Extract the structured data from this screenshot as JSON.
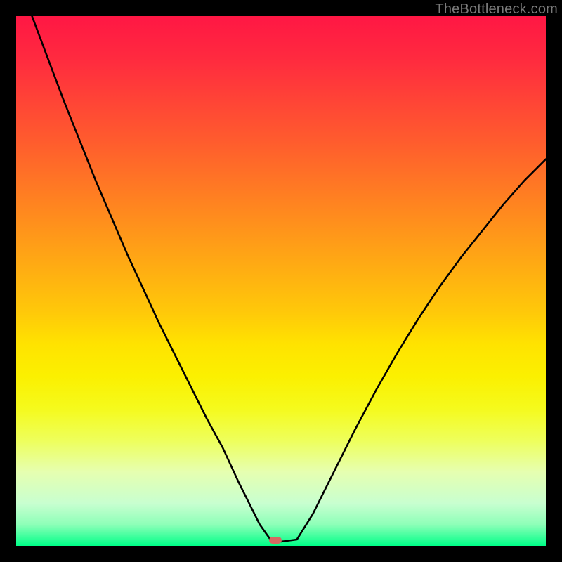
{
  "watermark": "TheBottleneck.com",
  "marker": {
    "x_pct": 49.0,
    "y_pct": 99.0
  },
  "chart_data": {
    "type": "line",
    "title": "",
    "xlabel": "",
    "ylabel": "",
    "xlim": [
      0,
      100
    ],
    "ylim": [
      0,
      100
    ],
    "grid": false,
    "legend": false,
    "series": [
      {
        "name": "bottleneck-curve",
        "x": [
          0,
          3,
          6,
          9,
          12,
          15,
          18,
          21,
          24,
          27,
          30,
          33,
          36,
          39,
          42,
          44,
          46,
          48,
          50,
          53,
          56,
          60,
          64,
          68,
          72,
          76,
          80,
          84,
          88,
          92,
          96,
          100
        ],
        "y": [
          108,
          100,
          92,
          84,
          76.5,
          69,
          62,
          55,
          48.5,
          42,
          36,
          30,
          24,
          18.5,
          12,
          8,
          4,
          1.2,
          0.8,
          1.2,
          6,
          14,
          22,
          29.5,
          36.5,
          43,
          49,
          54.5,
          59.5,
          64.5,
          69,
          73
        ]
      }
    ],
    "annotations": [
      {
        "type": "marker",
        "x": 49,
        "y": 0.8,
        "label": "optimal-point"
      }
    ],
    "background_gradient": {
      "direction": "vertical",
      "stops": [
        {
          "pos": 0,
          "color": "#ff1744"
        },
        {
          "pos": 50,
          "color": "#ffae12"
        },
        {
          "pos": 70,
          "color": "#ffe300"
        },
        {
          "pos": 100,
          "color": "#00ff88"
        }
      ]
    }
  }
}
